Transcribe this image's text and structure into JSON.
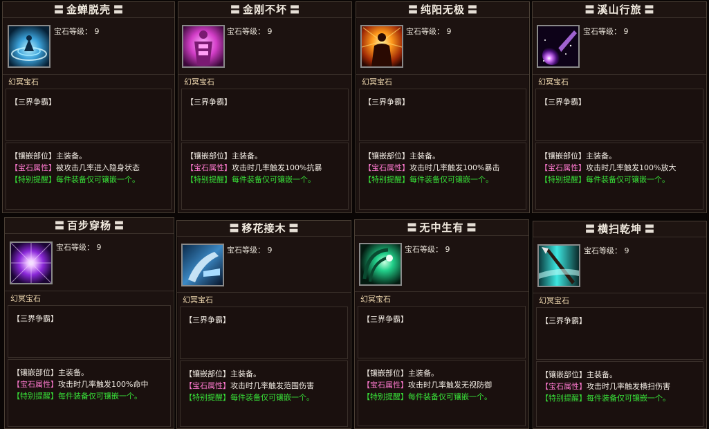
{
  "level_label": "宝石等级：",
  "level_value": "9",
  "gem_name": "幻冥宝石",
  "realm_label": "【三界争霸】",
  "slot_label": "【镶嵌部位】",
  "slot_value": "主装备。",
  "attr_label": "【宝石属性】",
  "note_label": "【特别提醒】",
  "note_value": "每件装备仅可镶嵌一个。",
  "cards": [
    {
      "title": "金蝉脱壳",
      "icon": "meditation-vortex-icon",
      "attr": "被攻击几率进入隐身状态"
    },
    {
      "title": "金刚不坏",
      "icon": "pink-armored-figure-icon",
      "attr": "攻击时几率触发100%抗暴"
    },
    {
      "title": "纯阳无极",
      "icon": "fiery-silhouette-icon",
      "attr": "攻击时几率触发100%暴击"
    },
    {
      "title": "溪山行旅",
      "icon": "purple-comet-icon",
      "attr": "攻击时几率触发100%放大"
    },
    {
      "title": "百步穿杨",
      "icon": "purple-burst-orb-icon",
      "attr": "攻击时几率触发100%命中"
    },
    {
      "title": "移花接木",
      "icon": "frost-gauntlet-icon",
      "attr": "攻击时几率触发范围伤害"
    },
    {
      "title": "无中生有",
      "icon": "green-spiral-icon",
      "attr": "攻击时几率触发无视防御"
    },
    {
      "title": "横扫乾坤",
      "icon": "cyan-spear-slash-icon",
      "attr": "攻击时几率触发横扫伤害"
    }
  ]
}
